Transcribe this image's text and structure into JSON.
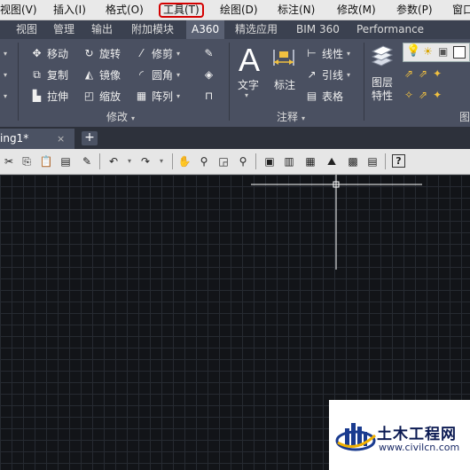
{
  "menu": {
    "items": [
      "视图(V)",
      "插入(I)",
      "格式(O)",
      "工具(T)",
      "绘图(D)",
      "标注(N)",
      "修改(M)",
      "参数(P)",
      "窗口"
    ],
    "highlighted": "工具(T)",
    "highlight_color": "#d40000"
  },
  "ribbon_tabs": {
    "items": [
      "视图",
      "管理",
      "输出",
      "附加模块",
      "A360",
      "精选应用",
      "BIM 360",
      "Performance"
    ],
    "active": "A360"
  },
  "modify_panel": {
    "title": "修改",
    "buttons": [
      "移动",
      "旋转",
      "修剪",
      "复制",
      "镜像",
      "圆角",
      "拉伸",
      "缩放",
      "阵列"
    ]
  },
  "annotation_panel": {
    "title": "注释",
    "text_label": "文字",
    "dimension_label": "标注",
    "linear_label": "线性",
    "leader_label": "引线",
    "table_label": "表格"
  },
  "layers_panel": {
    "properties_label": "图层\n特性",
    "title_partial": "图"
  },
  "document_tab": {
    "label": "ing1*",
    "close": "×",
    "new_tab": "+"
  },
  "watermark": {
    "name": "土木工程网",
    "url": "www.civilcn.com"
  },
  "colors": {
    "menubar_bg": "#e9e9e9",
    "ribbon_bg": "#4a5061",
    "canvas_bg": "#121418",
    "grid": "#262a31",
    "crosshair": "#ffffff"
  }
}
